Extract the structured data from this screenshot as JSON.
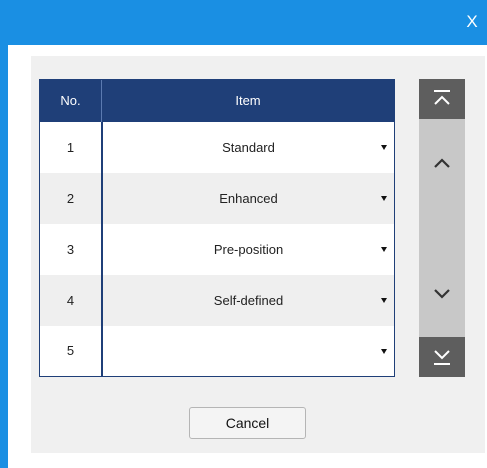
{
  "dialog": {
    "close_label": "X"
  },
  "table": {
    "header_no": "No.",
    "header_item": "Item",
    "rows": [
      {
        "no": "1",
        "item": "Standard"
      },
      {
        "no": "2",
        "item": "Enhanced"
      },
      {
        "no": "3",
        "item": "Pre-position"
      },
      {
        "no": "4",
        "item": "Self-defined"
      },
      {
        "no": "5",
        "item": ""
      }
    ]
  },
  "footer": {
    "cancel_label": "Cancel"
  },
  "colors": {
    "titlebar": "#1a8fe3",
    "header": "#1f3f78",
    "scroll_button": "#5e5e5e"
  },
  "icons": [
    "close-icon",
    "caret-down-icon",
    "scroll-top-icon",
    "chevron-up-icon",
    "chevron-down-icon",
    "scroll-bottom-icon"
  ]
}
